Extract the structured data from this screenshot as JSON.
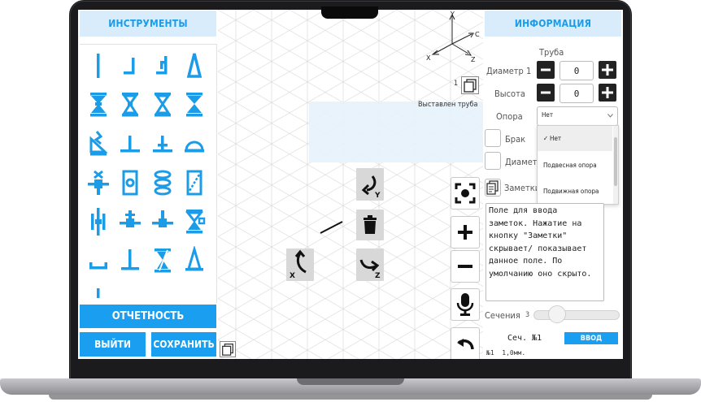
{
  "left_panel": {
    "header": "ИНСТРУМЕНТЫ",
    "report_button": "ОТЧЕТНОСТЬ",
    "exit_button": "ВЫЙТИ",
    "save_button": "СОХРАНИТЬ"
  },
  "canvas": {
    "axes": {
      "y": "Y",
      "x": "X",
      "z": "Z",
      "c": "C"
    },
    "layer_number": "1",
    "status_text": "Выставлен труба",
    "rotate_y_label": "Y",
    "rotate_x_label": "X",
    "rotate_z_label": "Z"
  },
  "right_panel": {
    "header": "ИНФОРМАЦИЯ",
    "section_title": "Труба",
    "diameter_label": "Диаметр 1",
    "diameter_value": "0",
    "height_label": "Высота",
    "height_value": "0",
    "support_label": "Опора",
    "support_value": "Нет",
    "support_options": [
      "Нет",
      "Подвесная опора",
      "Подвижная опора"
    ],
    "defect_label": "Брак",
    "diameter2_label": "Диаметр",
    "notes_label": "Заметки",
    "notes_text": "Поле для ввода заметок. Нажатие на кнопку \"Заметки\" скрывает/ показывает данное поле. По умолчанию оно скрыто.",
    "sections_label": "Сечения",
    "sections_value": "3",
    "section_name": "Сеч. №1",
    "enter_button": "ВВОД",
    "section_info": "№1  1,0мм."
  },
  "colors": {
    "accent": "#1a9ff0",
    "header_bg": "#d9ecfb",
    "tool_icon": "#1c9ce6"
  }
}
